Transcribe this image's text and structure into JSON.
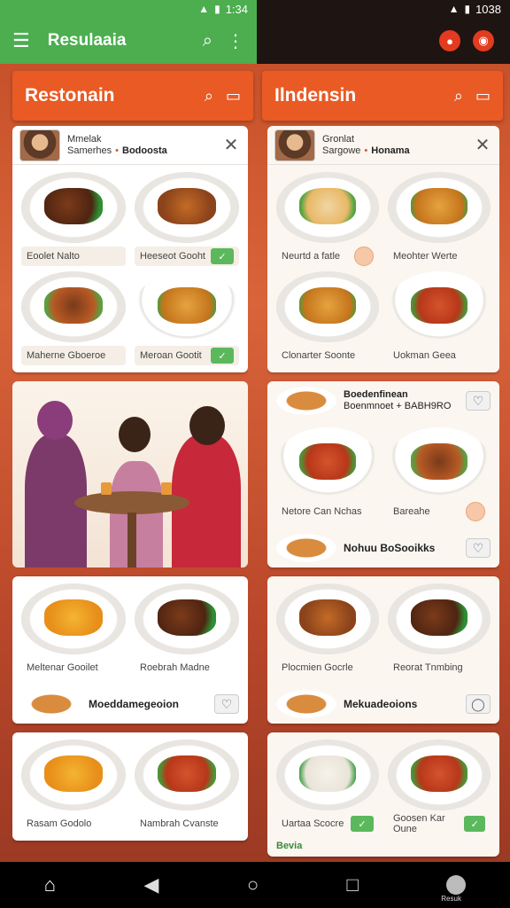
{
  "status_left": {
    "time": "1:34"
  },
  "status_right": {
    "time": "1038"
  },
  "appbar_left": {
    "title": "Resulaaia",
    "menu_icon": "hamburger-icon",
    "search_icon": "search-icon",
    "more_icon": "more-vert-icon"
  },
  "panel_left": {
    "title": "Restonain",
    "profile": {
      "line1": "Mmelak",
      "line2": "Samerhes",
      "tag": "Bodoosta"
    },
    "dishes": [
      {
        "label": "Eoolet Nalto",
        "badge": ""
      },
      {
        "label": "Heeseot Gooht",
        "badge": "check"
      },
      {
        "label": "Maherne Gboeroe",
        "badge": "stars"
      },
      {
        "label": "Meroan Gootit",
        "badge": "check"
      }
    ],
    "dishes2": [
      {
        "label": "Meltenar Gooilet"
      },
      {
        "label": "Roebrah Madne"
      }
    ],
    "strip_label": "Moeddamegeoion",
    "dishes3": [
      {
        "label": "Rasam Godolo"
      },
      {
        "label": "Nambrah Cvanste"
      }
    ]
  },
  "panel_right": {
    "title": "Ilndensin",
    "profile": {
      "line1": "Gronlat",
      "line2": "Sargowe",
      "tag": "Honama"
    },
    "dishes": [
      {
        "label": "Neurtd a fatle"
      },
      {
        "label": "Meohter Werte"
      },
      {
        "label": "Clonarter Soonte"
      },
      {
        "label": "Uokman Geea"
      }
    ],
    "featured": {
      "title": "Boedenfinean",
      "subtitle": "Boenmnoet + BABH9RO"
    },
    "dishes2": [
      {
        "label": "Netore Can Nchas"
      },
      {
        "label": "Bareahe"
      }
    ],
    "strip_label": "Nohuu BoSooikks",
    "dishes3": [
      {
        "label": "Plocmien Gocrle"
      },
      {
        "label": "Reorat Tnmbing"
      }
    ],
    "strip2_label": "Mekuadeoions",
    "dishes4": [
      {
        "label": "Uartaa Scocre"
      },
      {
        "label": "Goosen Kar Oune"
      }
    ],
    "bottom_tag": "Bevia"
  },
  "navbar": {
    "home_icon": "home-icon",
    "back_icon": "back-icon",
    "circle_icon": "home-circle-icon",
    "recent_icon": "recent-icon",
    "profile_caption": "Resuk"
  },
  "colors": {
    "green": "#4cae4f",
    "orange": "#ea5a24",
    "dark": "#1e1411"
  }
}
